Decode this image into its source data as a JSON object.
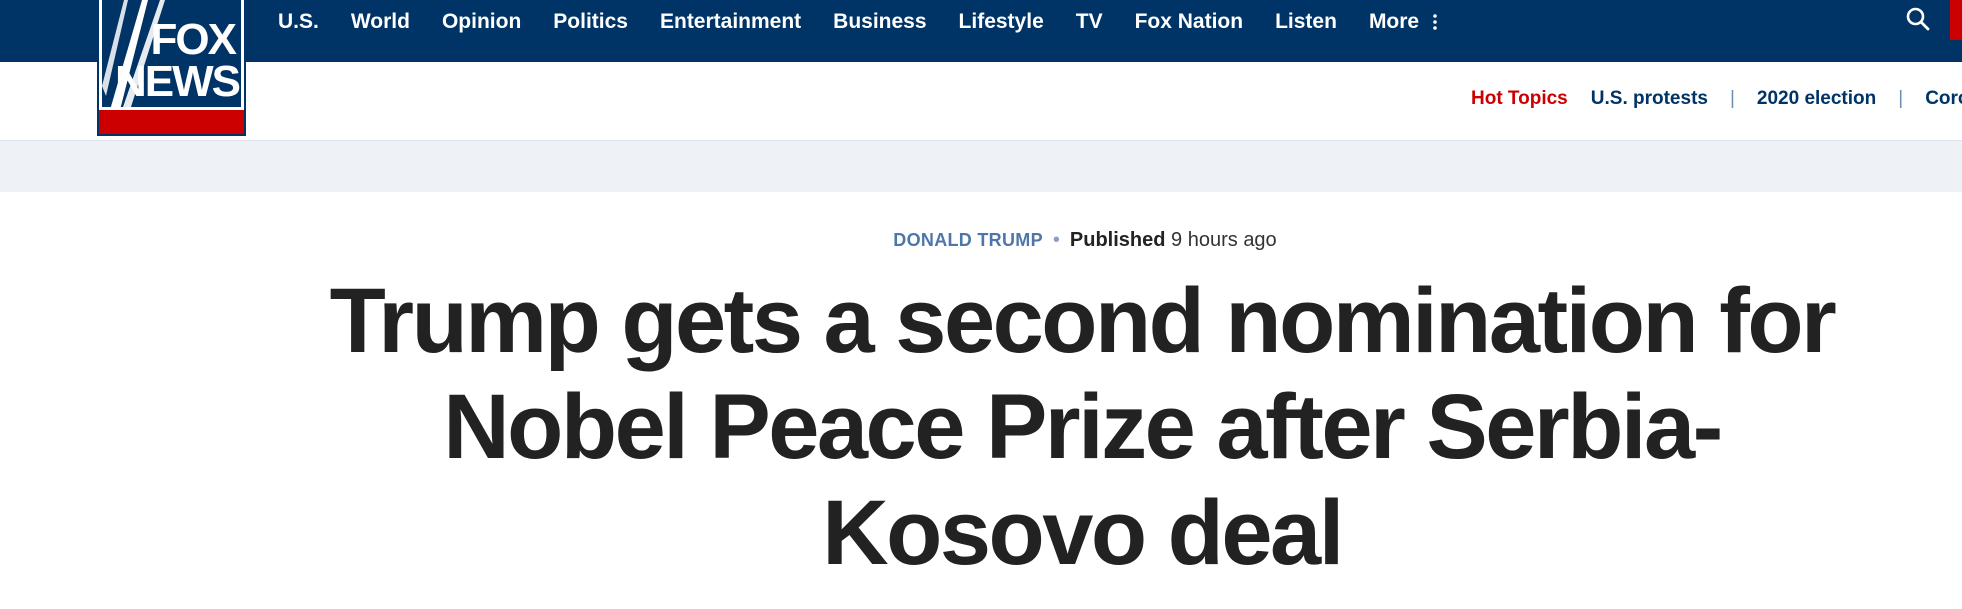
{
  "brand": {
    "logo_line1": "FOX",
    "logo_line2": "NEWS",
    "colors": {
      "navy": "#003366",
      "red": "#cc0000",
      "link_blue": "#4f76a8"
    }
  },
  "nav": {
    "items": [
      "U.S.",
      "World",
      "Opinion",
      "Politics",
      "Entertainment",
      "Business",
      "Lifestyle",
      "TV",
      "Fox Nation",
      "Listen",
      "More"
    ],
    "more_icon": "vertical-dots-icon",
    "search_icon": "search-icon"
  },
  "topics": {
    "label": "Hot Topics",
    "links": [
      "U.S. protests",
      "2020 election",
      "Corona"
    ],
    "separator": "|"
  },
  "article": {
    "eyebrow": "DONALD TRUMP",
    "dot": "•",
    "published_label": "Published",
    "published_time": "9 hours ago",
    "headline": "Trump gets a second nomination for Nobel Peace Prize after Serbia-Kosovo deal"
  }
}
